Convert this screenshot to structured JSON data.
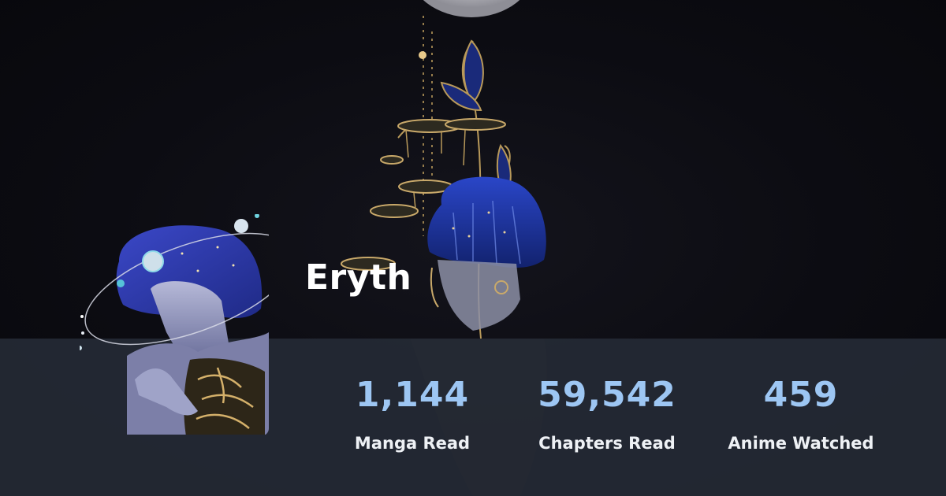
{
  "profile": {
    "username": "Eryth"
  },
  "stats": [
    {
      "value": "1,144",
      "label": "Manga Read"
    },
    {
      "value": "59,542",
      "label": "Chapters Read"
    },
    {
      "value": "459",
      "label": "Anime Watched"
    }
  ],
  "colors": {
    "stat_value": "#9dc6f3",
    "stat_label": "#eef1f5",
    "panel": "#242934",
    "background": "#0d0d12"
  },
  "images": {
    "banner": "banner-illustration",
    "avatar": "avatar-illustration"
  }
}
